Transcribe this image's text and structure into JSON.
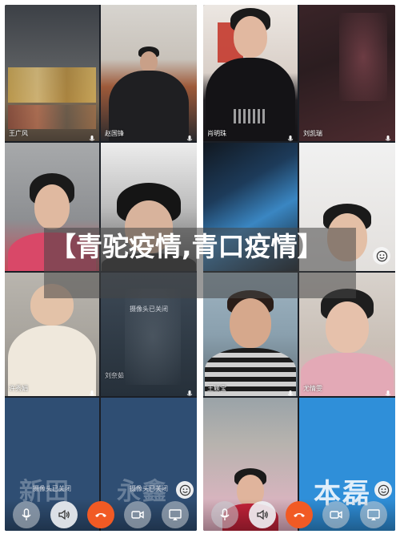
{
  "colors": {
    "hangup": "#f15a24",
    "banner_bg": "rgba(70,70,70,0.55)",
    "label_text": "#ffffff"
  },
  "title_overlay": {
    "text": "【青驼疫情,青口疫情】"
  },
  "left_screen": {
    "tiles": [
      {
        "name": "王广风",
        "mic": "mic-icon"
      },
      {
        "name": "赵国锋",
        "mic": "mic-icon"
      },
      {
        "name": "",
        "mic": ""
      },
      {
        "name": "",
        "mic": ""
      },
      {
        "name": "许秀娟",
        "mic": "mic-icon"
      },
      {
        "name": "刘奈茹",
        "mic": "mic-icon",
        "camera_off": "摄像头已关闭"
      }
    ],
    "bottom_row": {
      "left_camera_off": "摄像头已关闭",
      "left_watermark": "新田",
      "right_camera_off": "摄像头已关闭",
      "right_watermark": "永鑫"
    },
    "toolbar": [
      {
        "icon": "microphone-icon"
      },
      {
        "icon": "speaker-icon"
      },
      {
        "icon": "hang-up-icon"
      },
      {
        "icon": "video-camera-icon"
      },
      {
        "icon": "screen-share-icon"
      }
    ]
  },
  "right_screen": {
    "tiles": [
      {
        "name": "肖明珠",
        "mic": "mic-icon"
      },
      {
        "name": "刘凯瑞",
        "mic": "mic-icon"
      },
      {
        "name": "",
        "mic": ""
      },
      {
        "name": "",
        "mic": ""
      },
      {
        "name": "王颖宝",
        "mic": "mic-icon"
      },
      {
        "name": "尤情雯",
        "mic": "mic-icon"
      }
    ],
    "bottom_row": {
      "right_watermark": "本磊"
    },
    "toolbar": [
      {
        "icon": "microphone-icon"
      },
      {
        "icon": "speaker-icon"
      },
      {
        "icon": "hang-up-icon"
      },
      {
        "icon": "video-camera-icon"
      },
      {
        "icon": "screen-share-icon"
      }
    ]
  }
}
